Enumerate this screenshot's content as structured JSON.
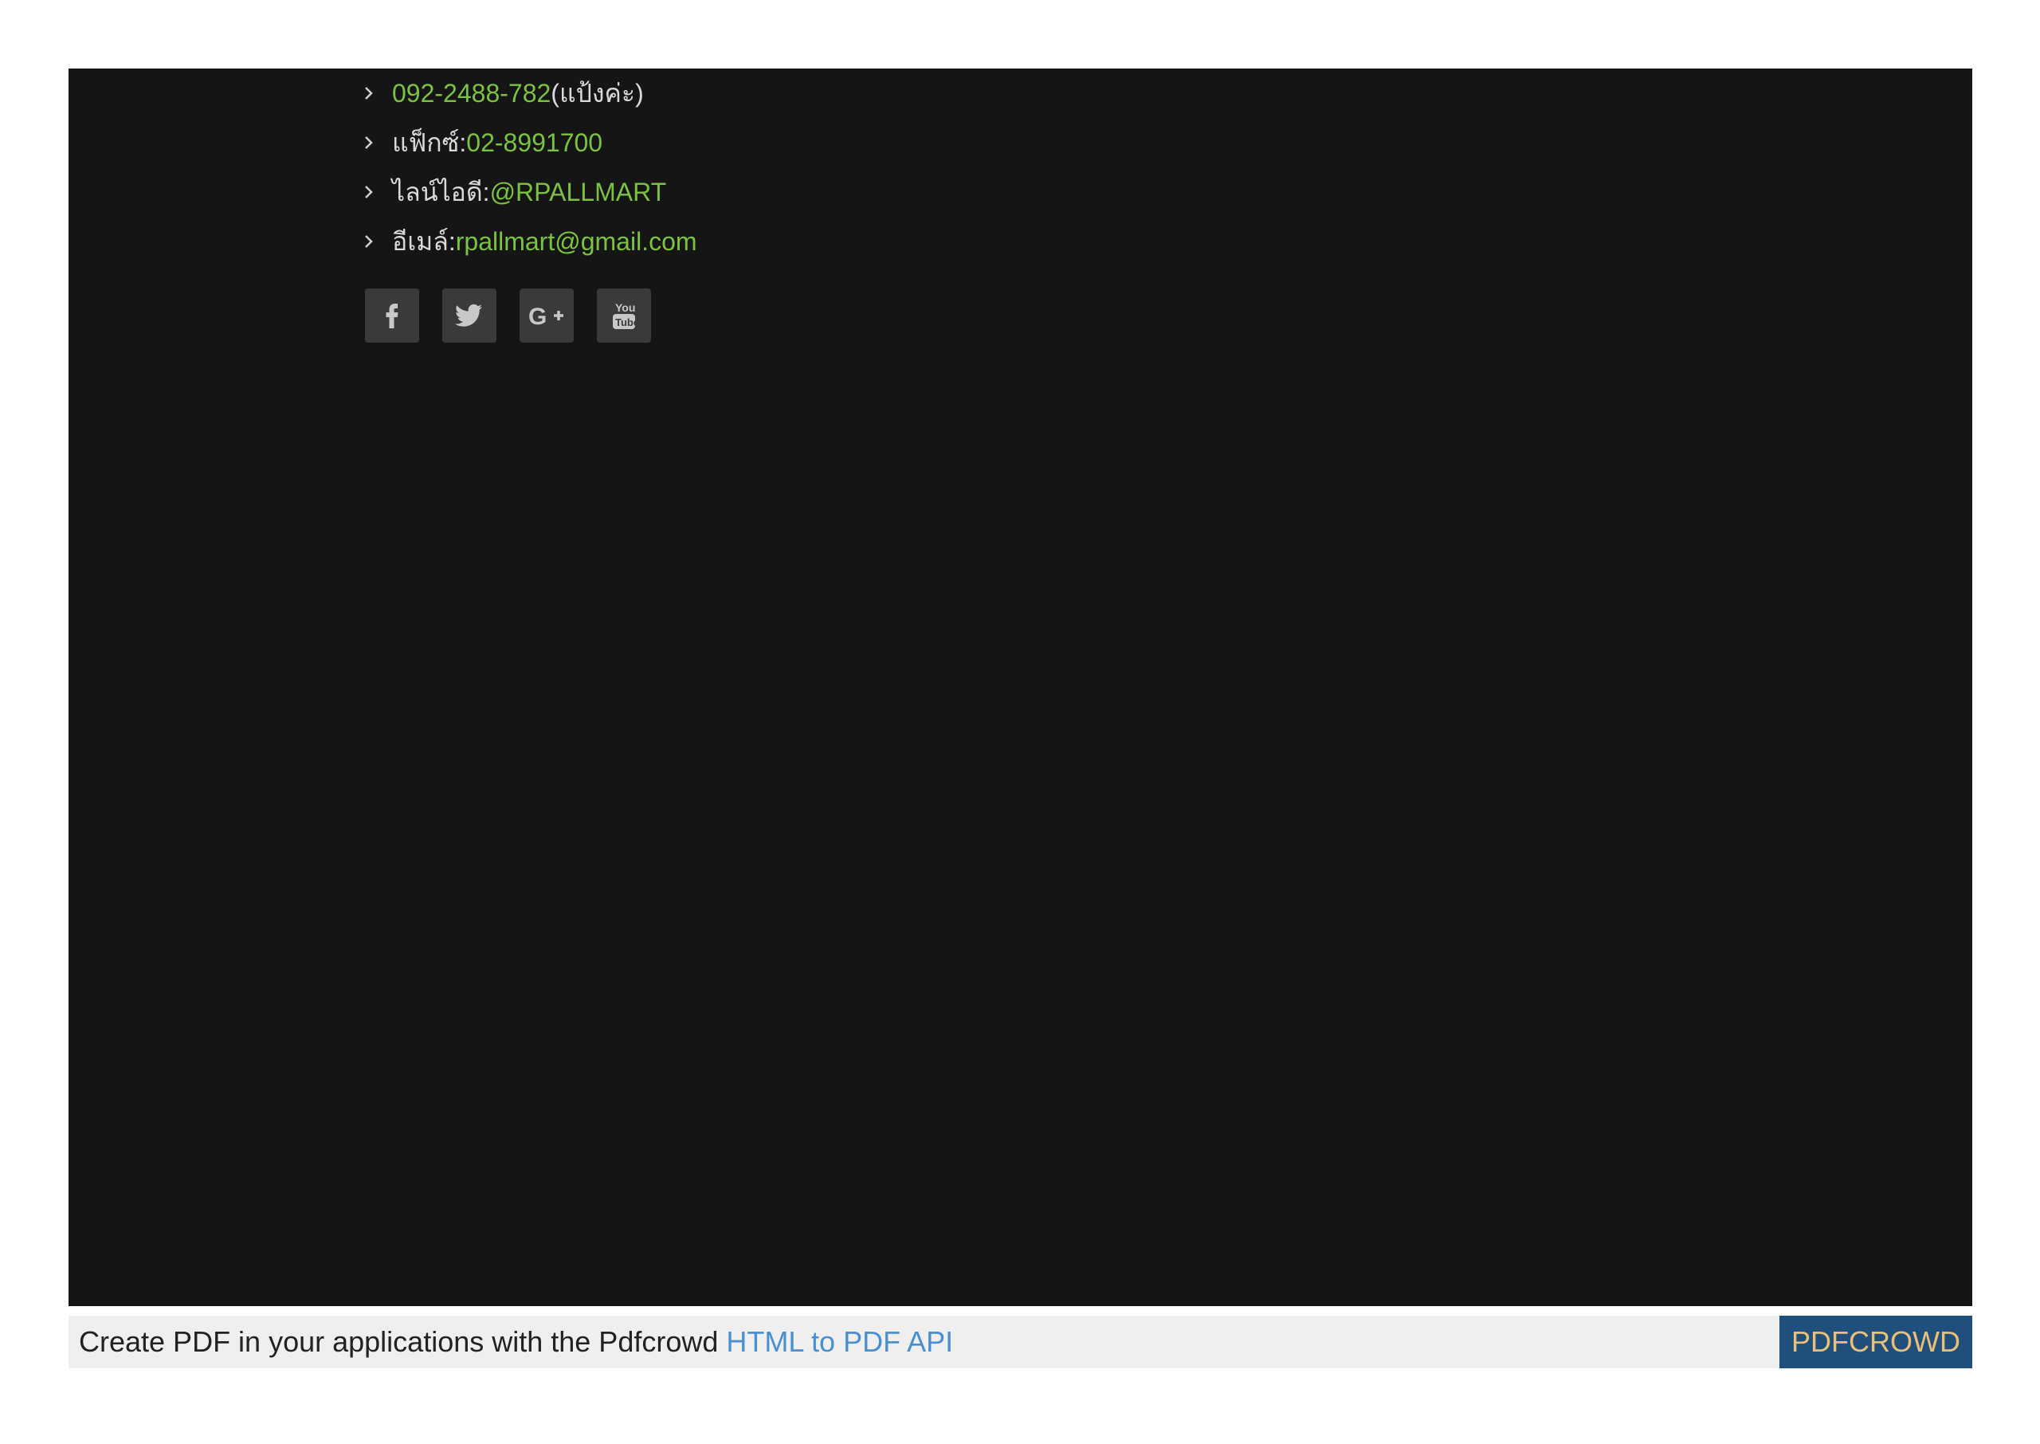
{
  "contacts": [
    {
      "label": "",
      "value": "092-2488-782",
      "suffix": " (แป้งค่ะ)"
    },
    {
      "label": "แฟ็กซ์: ",
      "value": "02-8991700",
      "suffix": ""
    },
    {
      "label": "ไลน์ไอดี: ",
      "value": "@RPALLMART",
      "suffix": ""
    },
    {
      "label": "อีเมล์: ",
      "value": "rpallmart@gmail.com",
      "suffix": ""
    }
  ],
  "social": [
    {
      "icon": "facebook-icon"
    },
    {
      "icon": "twitter-icon"
    },
    {
      "icon": "google-plus-icon"
    },
    {
      "icon": "youtube-icon"
    }
  ],
  "pdf_bar": {
    "text": "Create PDF in your applications with the Pdfcrowd ",
    "link": "HTML to PDF API",
    "badge": "PDFCROWD"
  },
  "colors": {
    "panel_bg": "#151515",
    "accent_green": "#7cc242",
    "link_blue": "#4a90d0",
    "badge_bg": "#1f4f7a",
    "badge_text": "#e7c07a"
  }
}
